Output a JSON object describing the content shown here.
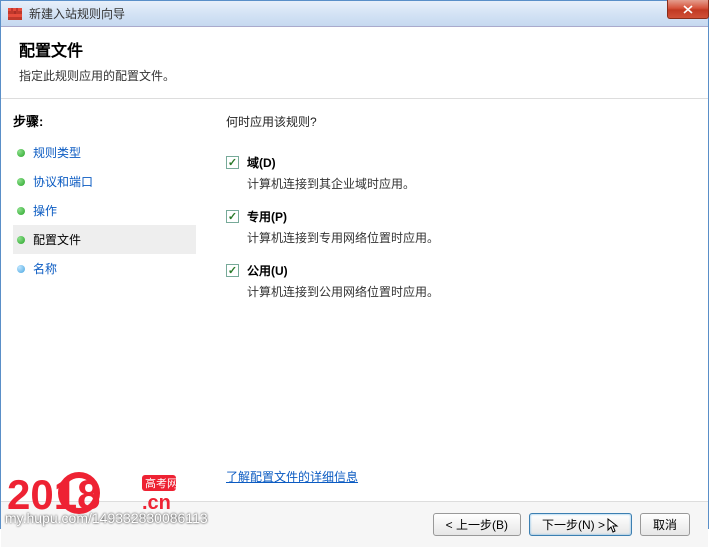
{
  "titlebar": {
    "title": "新建入站规则向导"
  },
  "header": {
    "title": "配置文件",
    "subtitle": "指定此规则应用的配置文件。"
  },
  "sidebar": {
    "heading": "步骤:",
    "items": [
      {
        "label": "规则类型",
        "state": "done"
      },
      {
        "label": "协议和端口",
        "state": "done"
      },
      {
        "label": "操作",
        "state": "done"
      },
      {
        "label": "配置文件",
        "state": "active"
      },
      {
        "label": "名称",
        "state": "pending"
      }
    ]
  },
  "content": {
    "question": "何时应用该规则?",
    "options": [
      {
        "label": "域(D)",
        "desc": "计算机连接到其企业域时应用。",
        "checked": true
      },
      {
        "label": "专用(P)",
        "desc": "计算机连接到专用网络位置时应用。",
        "checked": true
      },
      {
        "label": "公用(U)",
        "desc": "计算机连接到公用网络位置时应用。",
        "checked": true
      }
    ],
    "learn_more": "了解配置文件的详细信息"
  },
  "footer": {
    "back": "< 上一步(B)",
    "next": "下一步(N) >",
    "cancel": "取消"
  },
  "watermark": {
    "logo_text": "2018",
    "sub": "高考网",
    "domain": ".cn",
    "url": "my.hupu.com/149332830086113"
  }
}
